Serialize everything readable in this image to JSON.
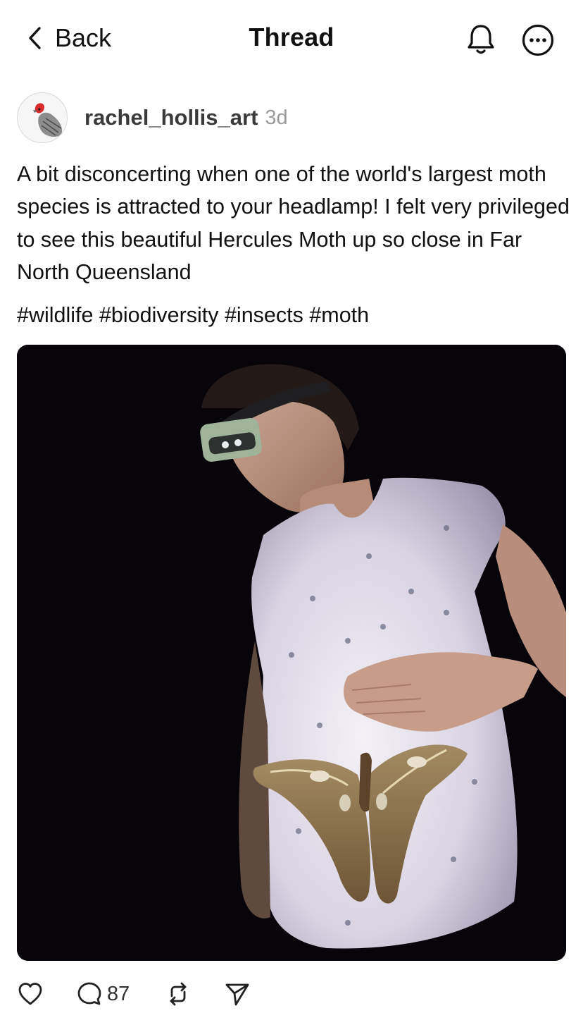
{
  "nav": {
    "back_label": "Back",
    "title": "Thread",
    "back_icon": "chevron-left-icon",
    "bell_icon": "bell-icon",
    "more_icon": "ellipsis-circle-icon"
  },
  "post": {
    "author": "rachel_hollis_art",
    "age": "3d",
    "text": "A bit disconcerting when one of the world's largest moth species is attracted to your headlamp! I felt very privileged to see this beautiful Hercules Moth up so close in Far North Queensland",
    "hashtags": "#wildlife #biodiversity #insects #moth"
  },
  "actions": {
    "like_icon": "heart-icon",
    "reply_icon": "comment-icon",
    "reply_count": "87",
    "repost_icon": "repost-icon",
    "share_icon": "send-icon"
  },
  "colors": {
    "text": "#111111",
    "muted": "#9a9a9a",
    "username": "#3a3a3a",
    "photo_bg": "#07050a"
  }
}
